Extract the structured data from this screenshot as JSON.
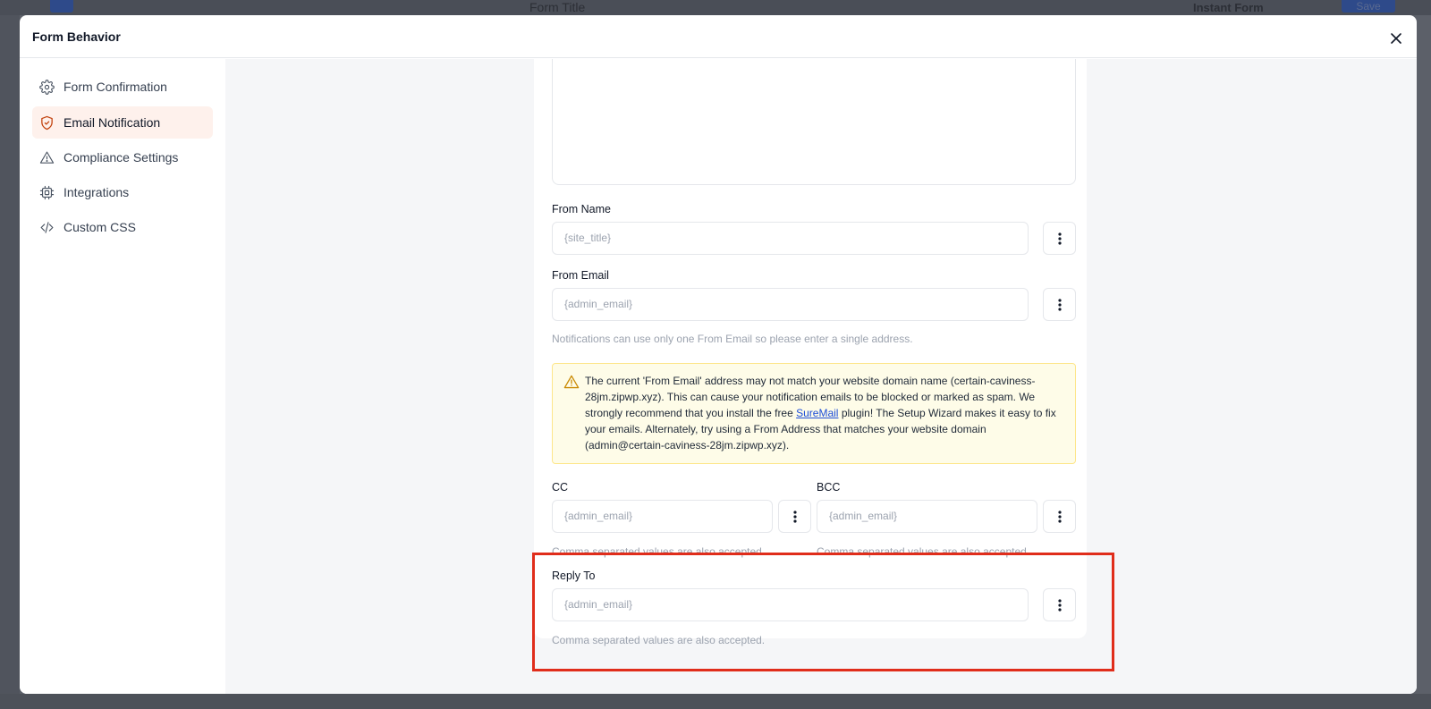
{
  "background": {
    "form_title": "Form Title",
    "instant_form": "Instant Form",
    "save": "Save"
  },
  "modal": {
    "title": "Form Behavior"
  },
  "sidebar": {
    "items": [
      {
        "label": "Form Confirmation",
        "icon": "gear-icon"
      },
      {
        "label": "Email Notification",
        "icon": "shield-icon",
        "active": true
      },
      {
        "label": "Compliance Settings",
        "icon": "warning-icon"
      },
      {
        "label": "Integrations",
        "icon": "chip-icon"
      },
      {
        "label": "Custom CSS",
        "icon": "code-icon"
      }
    ]
  },
  "form": {
    "from_name": {
      "label": "From Name",
      "placeholder": "{site_title}"
    },
    "from_email": {
      "label": "From Email",
      "placeholder": "{admin_email}",
      "help": "Notifications can use only one From Email so please enter a single address."
    },
    "warning": {
      "text_before_link": "The current 'From Email' address may not match your website domain name (certain-caviness-28jm.zipwp.xyz). This can cause your notification emails to be blocked or marked as spam. We strongly recommend that you install the free ",
      "link": "SureMail",
      "text_after_link": " plugin! The Setup Wizard makes it easy to fix your emails. Alternately, try using a From Address that matches your website domain (admin@certain-caviness-28jm.zipwp.xyz)."
    },
    "cc": {
      "label": "CC",
      "placeholder": "{admin_email}",
      "help": "Comma separated values are also accepted."
    },
    "bcc": {
      "label": "BCC",
      "placeholder": "{admin_email}",
      "help": "Comma separated values are also accepted."
    },
    "reply_to": {
      "label": "Reply To",
      "placeholder": "{admin_email}",
      "help": "Comma separated values are also accepted."
    }
  },
  "colors": {
    "accent": "#c2410c",
    "active_bg": "#fef1ec",
    "highlight": "#e02d1b",
    "warning_bg": "#fefce8"
  }
}
